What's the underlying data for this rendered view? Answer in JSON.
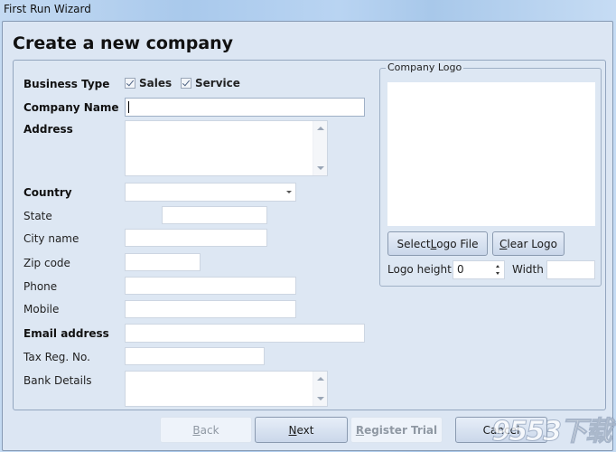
{
  "window": {
    "title": "First Run Wizard"
  },
  "page": {
    "title": "Create a new company"
  },
  "form": {
    "business_type": {
      "label": "Business Type",
      "options": [
        {
          "label": "Sales",
          "checked": true
        },
        {
          "label": "Service",
          "checked": true
        }
      ]
    },
    "company_name": {
      "label": "Company Name",
      "value": ""
    },
    "address": {
      "label": "Address",
      "value": ""
    },
    "country": {
      "label": "Country",
      "value": ""
    },
    "state": {
      "label": "State",
      "value": ""
    },
    "city": {
      "label": "City name",
      "value": ""
    },
    "zip": {
      "label": "Zip code",
      "value": ""
    },
    "phone": {
      "label": "Phone",
      "value": ""
    },
    "mobile": {
      "label": "Mobile",
      "value": ""
    },
    "email": {
      "label": "Email address",
      "value": ""
    },
    "tax": {
      "label": "Tax Reg. No.",
      "value": ""
    },
    "bank": {
      "label": "Bank Details",
      "value": ""
    }
  },
  "logo": {
    "group_label": "Company Logo",
    "select_button": {
      "pre": "Select ",
      "accel": "L",
      "post": "ogo File"
    },
    "clear_button": {
      "pre": "",
      "accel": "C",
      "post": "lear Logo"
    },
    "height_label": "Logo height",
    "height_value": "0",
    "width_label": "Width",
    "width_value": ""
  },
  "footer": {
    "back": {
      "pre": "",
      "accel": "B",
      "post": "ack",
      "enabled": false
    },
    "next": {
      "pre": "",
      "accel": "N",
      "post": "ext",
      "enabled": true
    },
    "register": {
      "pre": "",
      "accel": "R",
      "post": "egister Trial",
      "enabled": false
    },
    "cancel": {
      "label": "Cancel",
      "enabled": true
    }
  },
  "watermark": "9553下载"
}
